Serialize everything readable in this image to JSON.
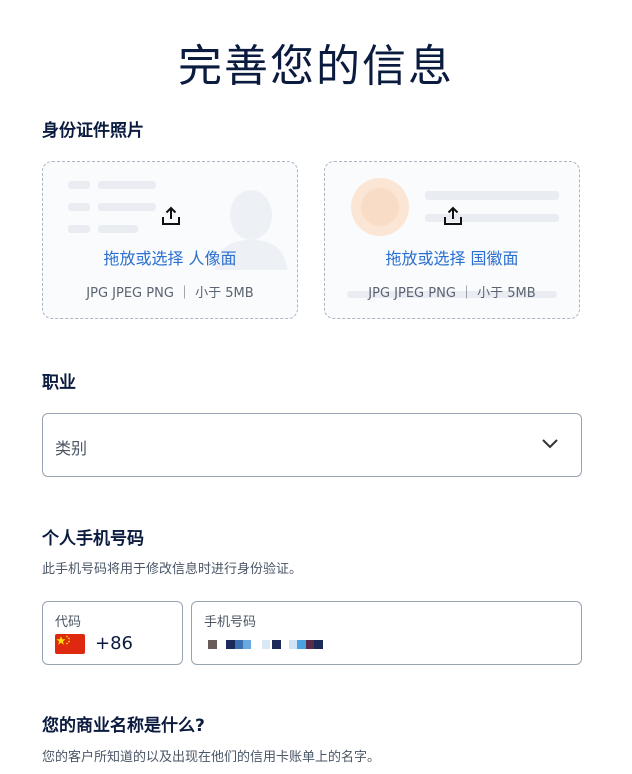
{
  "page": {
    "title": "完善您的信息"
  },
  "id_photo": {
    "label": "身份证件照片",
    "front": {
      "action": "拖放或选择 人像面",
      "hint": "JPG JPEG PNG ｜ 小于 5MB"
    },
    "back": {
      "action": "拖放或选择 国徽面",
      "hint": "JPG JPEG PNG ｜ 小于 5MB"
    }
  },
  "occupation": {
    "label": "职业",
    "select_value": "类别"
  },
  "phone": {
    "label": "个人手机号码",
    "helper": "此手机号码将用于修改信息时进行身份验证。",
    "code_label": "代码",
    "code_value": "+86",
    "number_label": "手机号码"
  },
  "business": {
    "label": "您的商业名称是什么?",
    "helper": "您的客户所知道的以及出现在他们的信用卡账单上的名字。"
  },
  "colors": {
    "accent": "#2a6fd1",
    "border": "#9aa3b1",
    "heading": "#0b1b3f"
  },
  "icons": [
    "upload-icon",
    "chevron-down-icon",
    "china-flag-icon"
  ]
}
